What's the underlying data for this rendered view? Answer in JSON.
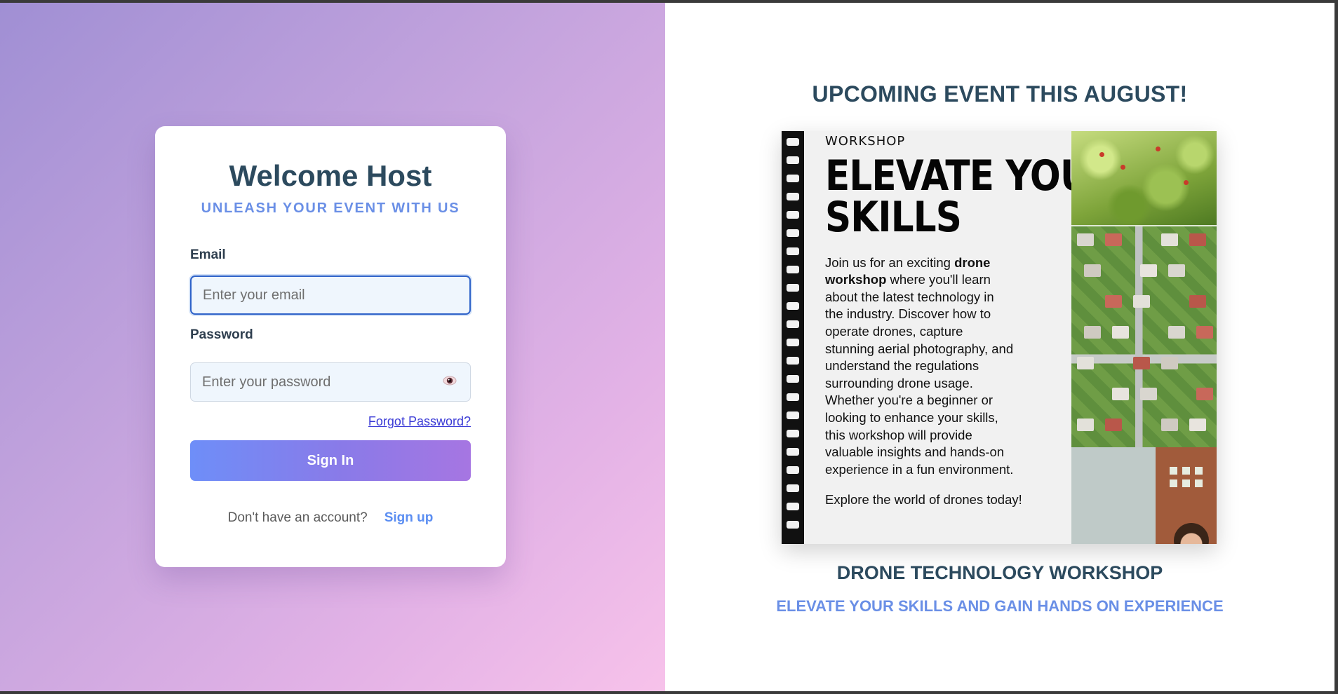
{
  "login": {
    "title": "Welcome Host",
    "subtitle": "UNLEASH YOUR EVENT WITH US",
    "email_label": "Email",
    "email_placeholder": "Enter your email",
    "email_value": "",
    "password_label": "Password",
    "password_placeholder": "Enter your password",
    "password_value": "",
    "forgot_password": "Forgot Password?",
    "sign_in": "Sign In",
    "no_account_text": "Don't have an account?",
    "sign_up": "Sign up",
    "toggle_icon": "eye-icon"
  },
  "event": {
    "heading": "UPCOMING EVENT THIS AUGUST!",
    "poster": {
      "label": "WORKSHOP",
      "title_line1": "ELEVATE YOUR",
      "title_line2": "SKILLS",
      "body_intro": "Join us for an exciting ",
      "body_bold": "drone workshop",
      "body_rest": " where you'll learn about the latest technology in the industry. Discover how to operate drones, capture stunning aerial photography, and understand the regulations surrounding drone usage. Whether you're a beginner or looking to enhance your skills, this workshop will provide valuable insights and hands-on experience in a fun environment.",
      "cta": "Explore the world of drones today!"
    },
    "name": "DRONE TECHNOLOGY WORKSHOP",
    "tagline": "ELEVATE YOUR SKILLS AND GAIN HANDS ON EXPERIENCE"
  },
  "colors": {
    "heading": "#2c4a5e",
    "accent_blue": "#6a8fe6",
    "button_gradient_start": "#6e8ef8",
    "button_gradient_end": "#a676e2",
    "link": "#3a3ad6"
  }
}
